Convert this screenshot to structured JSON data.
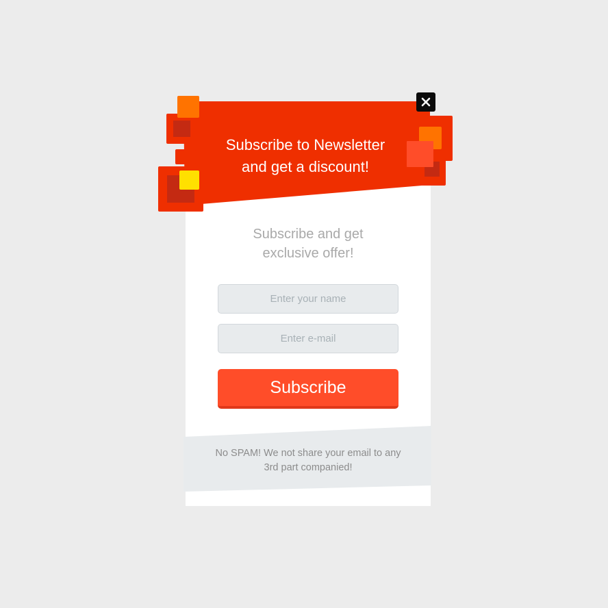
{
  "popup": {
    "title_line1": "Subscribe to Newsletter",
    "title_line2": "and get a discount!",
    "close_icon": "close-icon",
    "subhead_line1": "Subscribe and get",
    "subhead_line2": "exclusive offer!",
    "name_placeholder": "Enter your name",
    "email_placeholder": "Enter e-mail",
    "subscribe_label": "Subscribe",
    "notice_line1": "No SPAM! We not share your email to any",
    "notice_line2": "3rd part companied!"
  },
  "colors": {
    "banner": "#ef2f00",
    "banner_dark": "#c42a12",
    "accent_orange": "#ff7300",
    "accent_coral": "#ff4d29",
    "accent_yellow": "#ffe000",
    "background": "#ececec",
    "field_bg": "#e8ebed"
  }
}
